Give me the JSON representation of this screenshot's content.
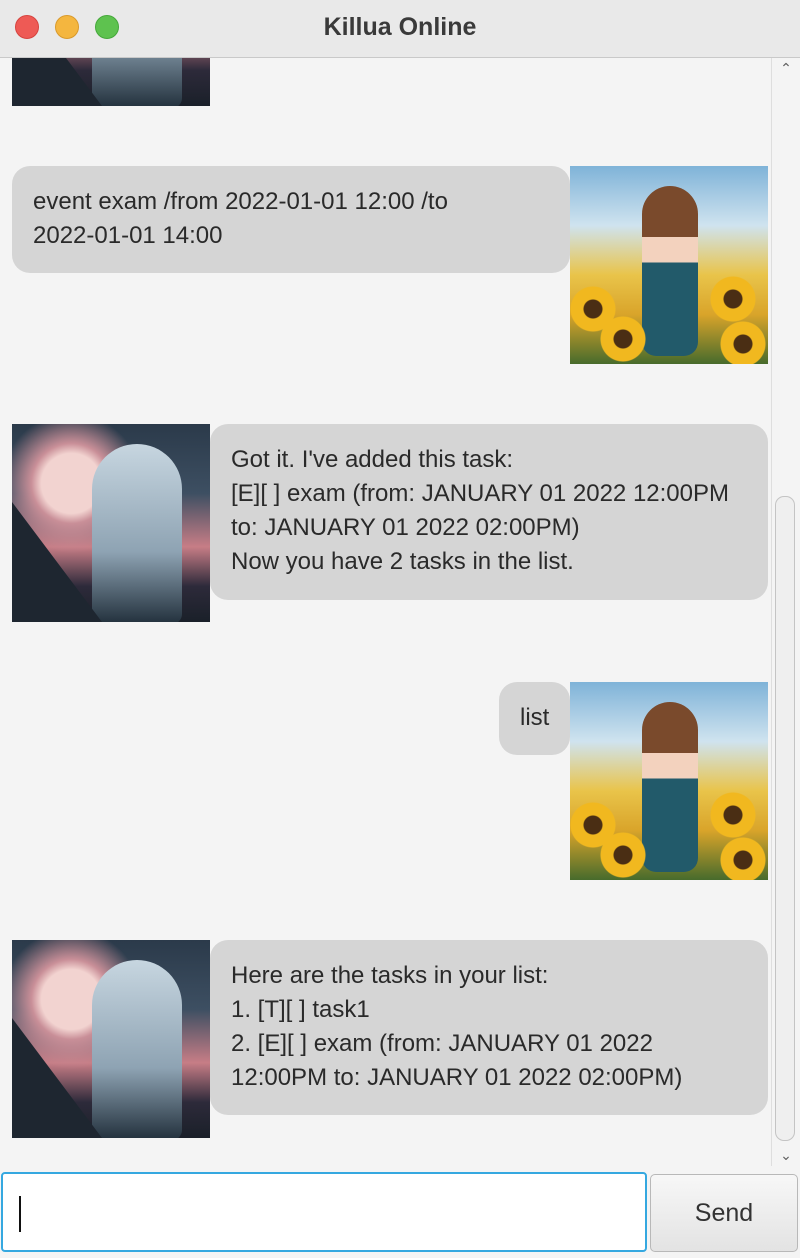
{
  "window": {
    "title": "Killua Online"
  },
  "messages": [
    {
      "sender": "user",
      "text": "event exam /from 2022-01-01 12:00 /to\n2022-01-01 14:00"
    },
    {
      "sender": "bot",
      "text": "Got it. I've added this task:\n[E][ ] exam (from: JANUARY 01 2022 12:00PM\nto: JANUARY 01 2022 02:00PM)\nNow you have 2 tasks in the list."
    },
    {
      "sender": "user",
      "text": "list"
    },
    {
      "sender": "bot",
      "text": "Here are the tasks in your list:\n1. [T][ ] task1\n2. [E][ ] exam (from: JANUARY 01 2022\n12:00PM to: JANUARY 01 2022 02:00PM)"
    }
  ],
  "avatars": {
    "bot": "night-girl-avatar",
    "user": "sunflower-girl-avatar"
  },
  "input": {
    "value": "",
    "placeholder": ""
  },
  "send_button": {
    "label": "Send"
  },
  "colors": {
    "bubble": "#d5d5d5",
    "focus_border": "#35a8e0",
    "background": "#f4f4f4"
  }
}
